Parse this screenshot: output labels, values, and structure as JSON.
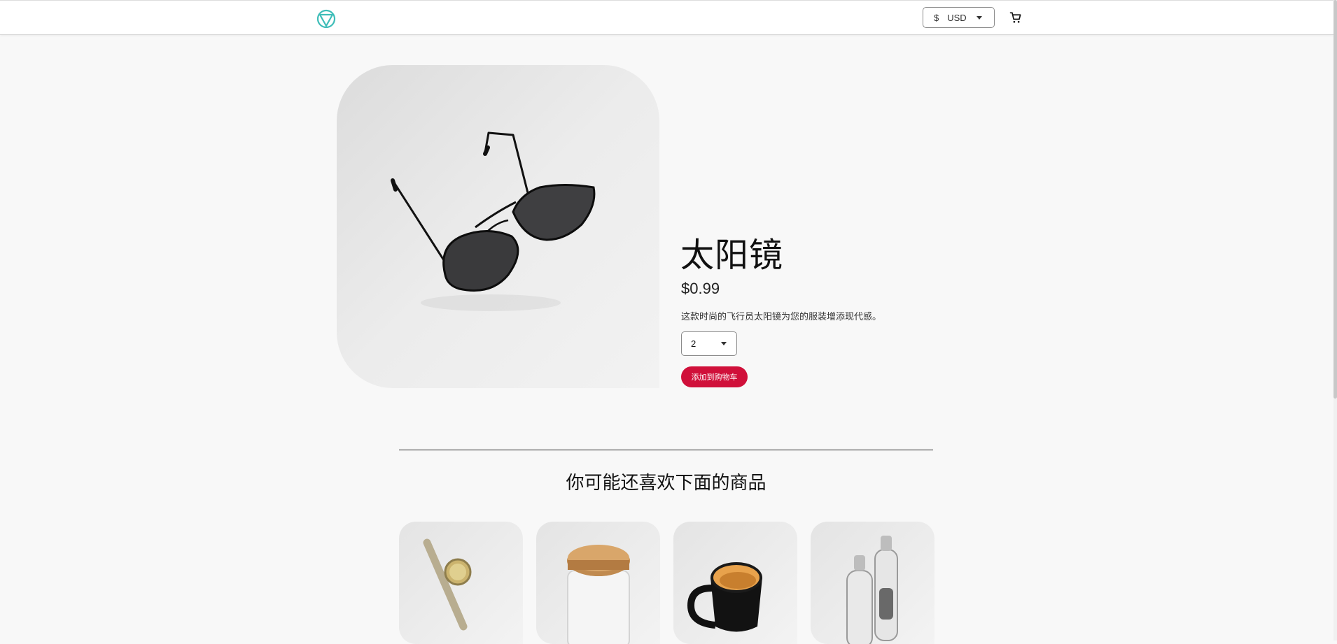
{
  "header": {
    "logo_icon": "hipster-logo-icon",
    "currency": {
      "symbol": "$",
      "code": "USD"
    },
    "cart_icon": "cart-icon"
  },
  "product": {
    "name": "太阳镜",
    "price": "$0.99",
    "description": "这款时尚的飞行员太阳镜为您的服装增添现代感。",
    "quantity": "2",
    "add_to_cart_label": "添加到购物车"
  },
  "recommendations": {
    "title": "你可能还喜欢下面的商品",
    "items": [
      {
        "image": "watch"
      },
      {
        "image": "bamboo-jar"
      },
      {
        "image": "mug"
      },
      {
        "image": "salt-pepper-shakers"
      }
    ]
  },
  "colors": {
    "accent": "#d0103a",
    "logo": "#3ebdb8",
    "background": "#f8f8f8"
  }
}
